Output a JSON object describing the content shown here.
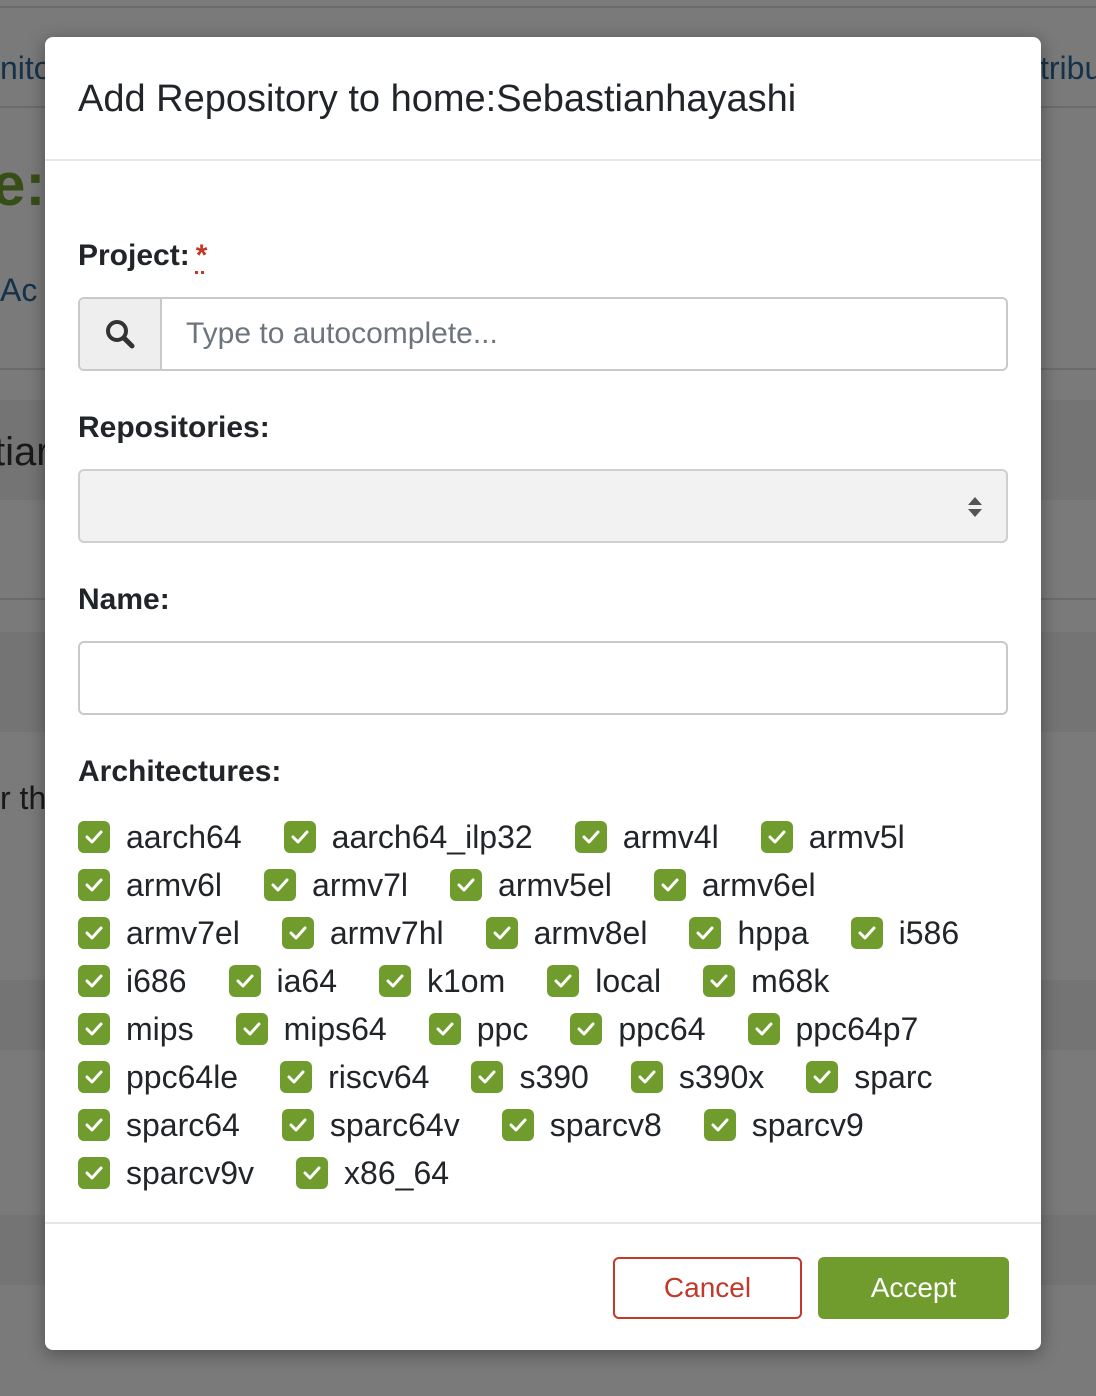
{
  "background": {
    "tab_left": "nito",
    "tab_right": "tribu",
    "project_fragment": "e:S",
    "link_fragment": "Ac",
    "heading_fragment": "tiar",
    "text_fragment": "r th"
  },
  "modal": {
    "title": "Add Repository to home:Sebastianhayashi",
    "project": {
      "label": "Project:",
      "required_mark": "*",
      "placeholder": "Type to autocomplete...",
      "value": ""
    },
    "repositories": {
      "label": "Repositories:",
      "selected": ""
    },
    "name": {
      "label": "Name:",
      "value": ""
    },
    "architectures": {
      "label": "Architectures:",
      "rows": [
        [
          "aarch64",
          "aarch64_ilp32",
          "armv4l",
          "armv5l"
        ],
        [
          "armv6l",
          "armv7l",
          "armv5el",
          "armv6el"
        ],
        [
          "armv7el",
          "armv7hl",
          "armv8el",
          "hppa",
          "i586"
        ],
        [
          "i686",
          "ia64",
          "k1om",
          "local",
          "m68k"
        ],
        [
          "mips",
          "mips64",
          "ppc",
          "ppc64",
          "ppc64p7"
        ],
        [
          "ppc64le",
          "riscv64",
          "s390",
          "s390x",
          "sparc"
        ],
        [
          "sparc64",
          "sparc64v",
          "sparcv8",
          "sparcv9"
        ],
        [
          "sparcv9v",
          "x86_64"
        ]
      ],
      "all_checked": true
    },
    "buttons": {
      "cancel": "Cancel",
      "accept": "Accept"
    }
  },
  "colors": {
    "accent_green": "#6f9c2c",
    "danger_red": "#c0392b",
    "link_blue": "#2a6496"
  },
  "icons": {
    "search": "search-icon",
    "select_arrows": "sort-arrows-icon",
    "checkbox": "checkmark-icon"
  }
}
